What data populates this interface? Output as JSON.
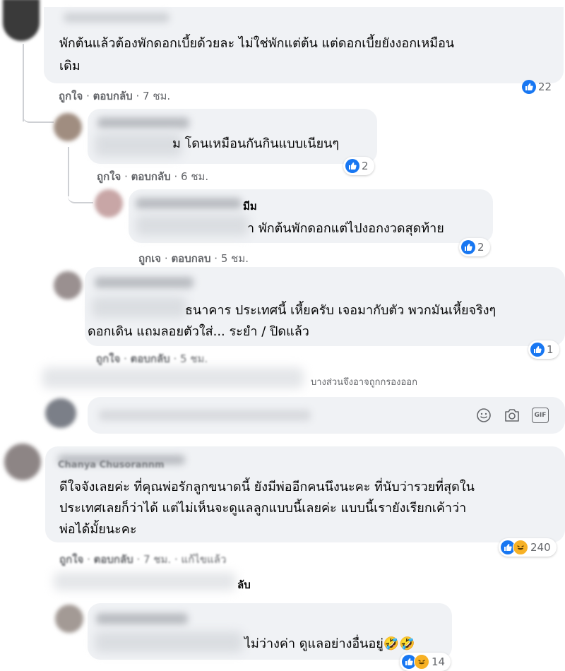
{
  "comments": [
    {
      "text_line1": "พักต้นแล้วต้องพักดอกเบี้ยด้วยละ ไม่ใช่พักแต่ต้น แต่ดอกเบี้ยยังงอกเหมือน",
      "text_line2": "เดิม",
      "like": "ถูกใจ",
      "reply": "ตอบกลับ",
      "time": "7 ชม.",
      "reaction_count": "22",
      "reactions": [
        "like-icon"
      ]
    },
    {
      "text": "ม โดนเหมือนกันกินแบบเนียนๆ",
      "like": "ถูกใจ",
      "reply": "ตอบกลับ",
      "time": "6 ชม.",
      "reaction_count": "2",
      "reactions": [
        "like-icon"
      ]
    },
    {
      "text_top": "มีม",
      "text": "า พักต้นพักดอกแต่ไปงอกงวดสุดท้าย",
      "like": "ถูกเจ",
      "reply": "ตอบกลบ",
      "time": "5 ชม.",
      "reaction_count": "2",
      "reactions": [
        "like-icon"
      ]
    },
    {
      "text_line1": "ธนาคาร ประเทศนี้ เหี้ยครับ เจอมากับตัว พวกมันเหี้ยจริงๆ",
      "text_line2": "ดอกเดิน แถมลอยตัวใส่... ระยำ / ปิดแล้ว",
      "like": "ถูกใจ",
      "reply": "ตอบกลับ",
      "time": "5 ชม.",
      "reaction_count": "1",
      "reactions": [
        "like-icon"
      ]
    },
    {
      "author_partial": "Chanya Chusorannm",
      "text_line1": "ดีใจจังเลยค่ะ ที่คุณพ่อรักลูกขนาดนี้ ยังมีพ่ออีกคนนึงนะคะ ที่นับว่ารวยที่สุดใน",
      "text_line2": "ประเทศเลยก็ว่าได้ แต่ไม่เห็นจะดูแลลูกแบบนี้เลยค่ะ แบบนี้เรายังเรียกเค้าว่า",
      "text_line3": "พ่อได้มั้ยนะคะ",
      "like": "ถูกใจ",
      "reply": "ตอบกลับ",
      "time": "7 ชม.",
      "edited": "แก้ไขแล้ว",
      "reaction_count": "240",
      "reactions": [
        "like-icon",
        "haha-icon"
      ]
    },
    {
      "text": "ไม่ว่างค่า ดูแลอย่างอื่นอยู่🤣🤣",
      "reaction_count": "14",
      "reactions": [
        "like-icon",
        "haha-icon"
      ]
    }
  ],
  "filter_notice": "บางส่วนจึงอาจถูกกรองออก",
  "hidden_reply_link": "ลับ",
  "composer": {
    "icons": [
      "emoji-icon",
      "camera-icon",
      "gif-icon"
    ],
    "gif_label": "GIF"
  },
  "separator": "·",
  "colors": {
    "like_blue": "#1877f2",
    "haha_yellow": "#f7b125",
    "bubble": "#f0f2f5",
    "meta_gray": "#65676b"
  }
}
